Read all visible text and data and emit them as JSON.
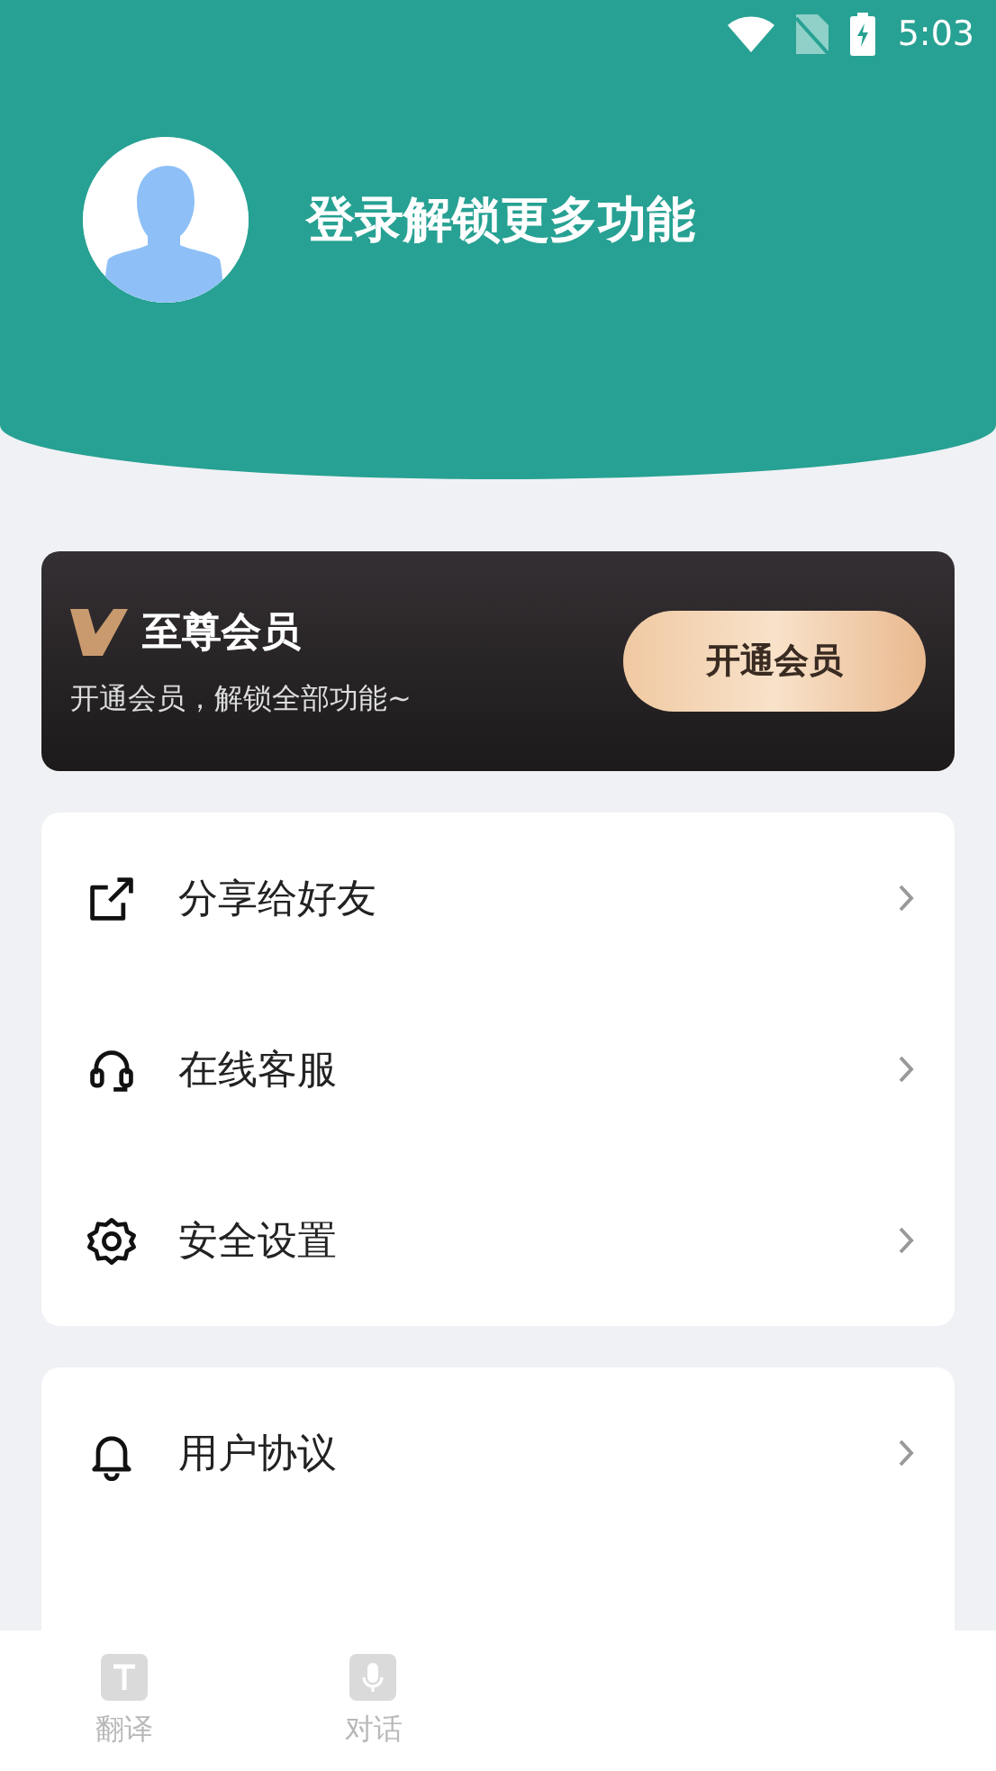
{
  "status_bar": {
    "time": "5:03"
  },
  "profile": {
    "title": "登录解锁更多功能"
  },
  "vip": {
    "title": "至尊会员",
    "subtitle": "开通会员，解锁全部功能~",
    "button": "开通会员"
  },
  "menu_groups": [
    {
      "items": [
        {
          "label": "分享给好友"
        },
        {
          "label": "在线客服"
        },
        {
          "label": "安全设置"
        }
      ]
    },
    {
      "items": [
        {
          "label": "用户协议"
        }
      ]
    }
  ],
  "tab_bar": [
    {
      "label": "翻译",
      "selected": false
    },
    {
      "label": "对话",
      "selected": false
    }
  ]
}
